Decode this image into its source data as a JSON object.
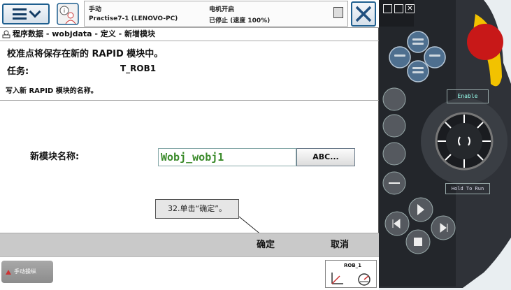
{
  "status": {
    "mode": "手动",
    "system": "Practise7-1 (LENOVO-PC)",
    "motors": "电机开启",
    "state": "已停止 (速度 100%)"
  },
  "breadcrumb": "程序数据 - wobjdata - 定义 - 新增模块",
  "content": {
    "hint_title": "校准点将保存在新的 RAPID 模块中。",
    "task_label": "任务:",
    "task_value": "T_ROB1",
    "write_hint": "写入新 RAPID 模块的名称。",
    "name_label": "新模块名称:",
    "name_value": "Wobj_wobj1",
    "abc_button": "ABC..."
  },
  "callout": "32.单击“确定”。",
  "actions": {
    "ok": "确定",
    "cancel": "取消"
  },
  "taskbar": {
    "jog_task": "手动操纵",
    "robot": "ROB_1"
  },
  "pendant": {
    "enable": "Enable",
    "hold_to_run": "Hold To Run"
  },
  "colors": {
    "button_border": "#1f5f8f",
    "input_text": "#3a8a2a",
    "action_bar": "#c9c9c9",
    "pendant_body": "#2f3238",
    "pendant_yellow": "#f2c200",
    "stop_red": "#c81818"
  },
  "icons": [
    "menu-icon",
    "info-icon",
    "close-icon",
    "program-data-icon",
    "jog-icon",
    "coordinate-icon",
    "speed-icon"
  ]
}
